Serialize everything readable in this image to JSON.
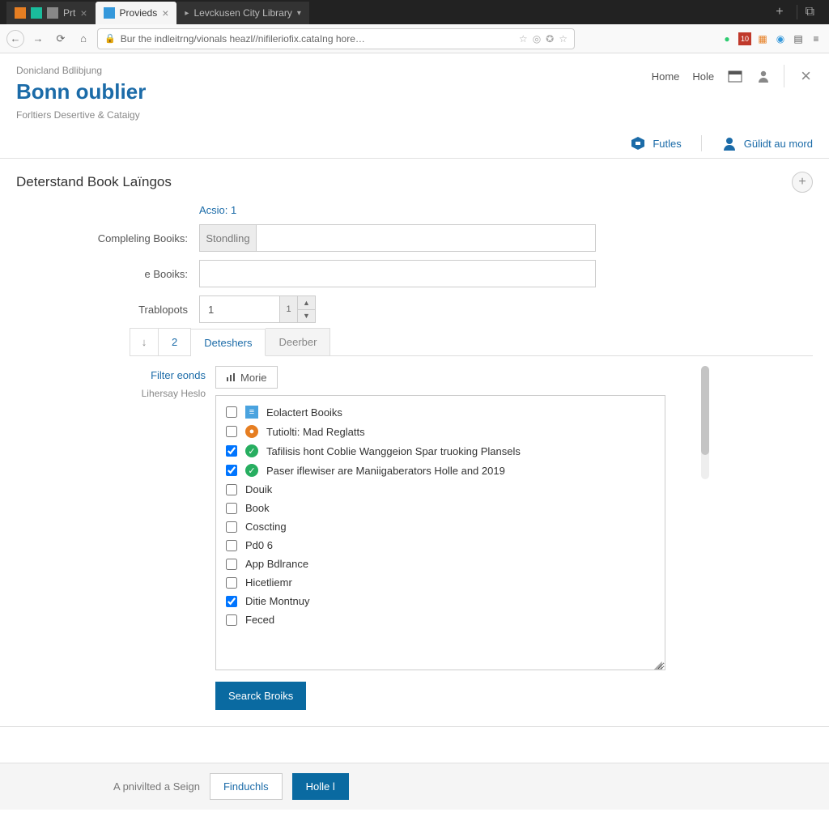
{
  "browser": {
    "tabs": [
      {
        "label": "Prt"
      },
      {
        "label": "Provieds"
      },
      {
        "label": "Levckusen City Library"
      }
    ],
    "url": "Bur the indleitrng/vionals heazl//nifileriofix.cataIng hore…"
  },
  "toolbar_icons": {
    "star": "☆",
    "shield": "◎",
    "globe": "✪",
    "star2": "☆"
  },
  "header": {
    "breadcrumb": "Donicland Bdlibjung",
    "title": "Bonn oublier",
    "subtitle": "Forltiers Desertive & Cataigy",
    "links": {
      "home": "Home",
      "hole": "Hole"
    }
  },
  "subnav": {
    "account1": "Futles",
    "account2": "Gülidt au mord"
  },
  "section": {
    "title": "Deterstand Book Laïngos",
    "action": "Acsio:  1"
  },
  "form": {
    "field1_label": "Compleling Booiks:",
    "field1_addon": "Stondling",
    "field1_value": "",
    "field2_label": "e Booiks:",
    "field2_value": "",
    "field3_label": "Trablopots",
    "field3_value": "1",
    "field3_suffix": "1"
  },
  "tabs": {
    "t1": "2",
    "t2": "Deteshers",
    "t3": "Deerber"
  },
  "filter": {
    "side_link": "Filter eonds",
    "side_label": "Lihersay Heslo",
    "more_btn": "Morie"
  },
  "list_items": [
    {
      "checked": false,
      "icon": "blue",
      "label": "Eolactert Booiks"
    },
    {
      "checked": false,
      "icon": "orange",
      "label": "Tutiolti: Mad Reglatts"
    },
    {
      "checked": true,
      "icon": "green",
      "label": "Tafilisis hont Coblie Wanggeion Spar truoking Plansels"
    },
    {
      "checked": true,
      "icon": "green",
      "label": "Paser iflewiser are Maniigaberators Holle and 2019"
    },
    {
      "checked": false,
      "icon": null,
      "label": "Douik"
    },
    {
      "checked": false,
      "icon": null,
      "label": "Book"
    },
    {
      "checked": false,
      "icon": null,
      "label": "Coscting"
    },
    {
      "checked": false,
      "icon": null,
      "label": "Pd0 6"
    },
    {
      "checked": false,
      "icon": null,
      "label": "App Bdlrance"
    },
    {
      "checked": false,
      "icon": null,
      "label": "Hicetliemr"
    },
    {
      "checked": true,
      "icon": null,
      "label": "Ditie Montnuy"
    },
    {
      "checked": false,
      "icon": null,
      "label": "Feced"
    }
  ],
  "search_btn": "Searck Broiks",
  "footer": {
    "label": "A pnivilted a Seign",
    "btn1": "Finduchls",
    "btn2": "Holle l"
  }
}
